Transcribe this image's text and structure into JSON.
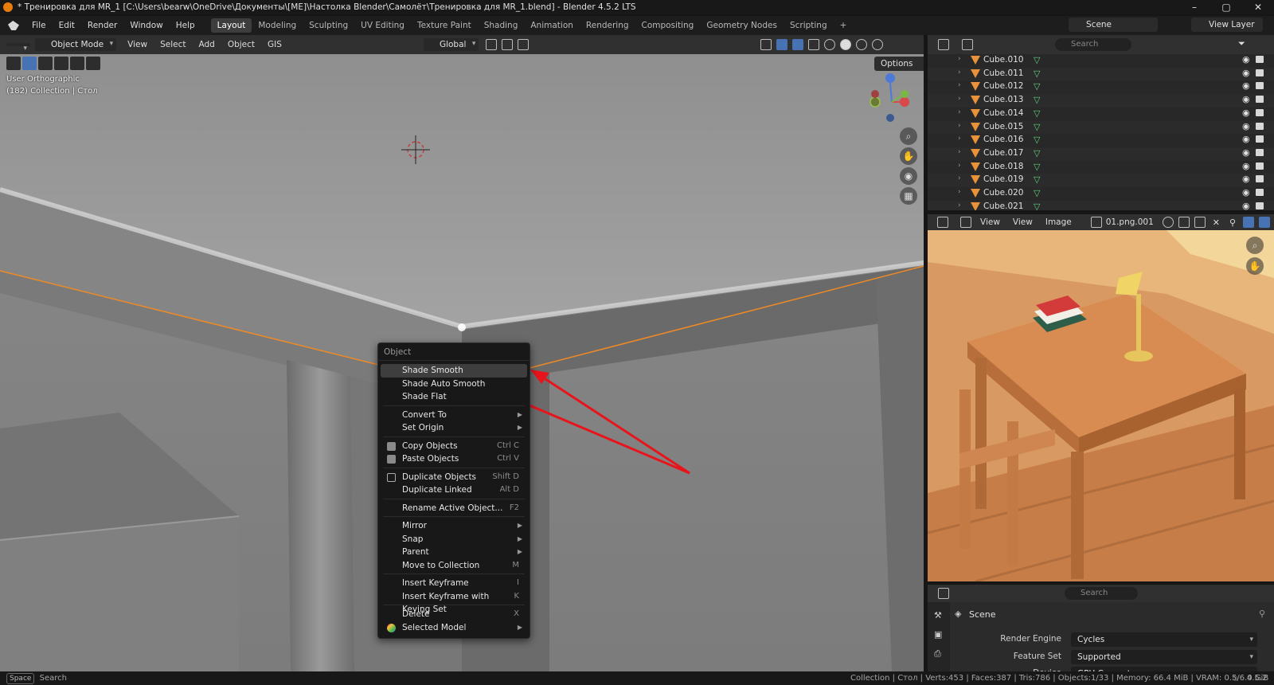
{
  "window": {
    "title": "* Тренировка для MR_1 [C:\\Users\\bearw\\OneDrive\\Документы\\[ME]\\Настолка Blender\\Самолёт\\Тренировка для MR_1.blend] - Blender 4.5.2 LTS",
    "minimize": "–",
    "maximize": "▢",
    "close": "✕"
  },
  "menu": [
    "File",
    "Edit",
    "Render",
    "Window",
    "Help"
  ],
  "workspaces": [
    "Layout",
    "Modeling",
    "Sculpting",
    "UV Editing",
    "Texture Paint",
    "Shading",
    "Animation",
    "Rendering",
    "Compositing",
    "Geometry Nodes",
    "Scripting"
  ],
  "active_workspace": "Layout",
  "add_workspace": "+",
  "scene": {
    "label": "Scene",
    "view_layer": "View Layer"
  },
  "viewport_header": {
    "mode": "Object Mode",
    "items": [
      "View",
      "Select",
      "Add",
      "Object",
      "GIS"
    ],
    "transform": "Global",
    "options": "Options"
  },
  "viewport_info": {
    "view": "User Orthographic",
    "collection": "(182) Collection | Стол"
  },
  "context_menu": {
    "title": "Object",
    "groups": [
      [
        {
          "label": "Shade Smooth",
          "shortcut": "",
          "highlight": true
        },
        {
          "label": "Shade Auto Smooth",
          "shortcut": ""
        },
        {
          "label": "Shade Flat",
          "shortcut": ""
        }
      ],
      [
        {
          "label": "Convert To",
          "submenu": true
        },
        {
          "label": "Set Origin",
          "submenu": true
        }
      ],
      [
        {
          "label": "Copy Objects",
          "shortcut": "Ctrl C",
          "icon": "copy-icon"
        },
        {
          "label": "Paste Objects",
          "shortcut": "Ctrl V",
          "icon": "paste-icon"
        }
      ],
      [
        {
          "label": "Duplicate Objects",
          "shortcut": "Shift D",
          "icon": "duplicate-icon"
        },
        {
          "label": "Duplicate Linked",
          "shortcut": "Alt D"
        }
      ],
      [
        {
          "label": "Rename Active Object...",
          "shortcut": "F2"
        }
      ],
      [
        {
          "label": "Mirror",
          "submenu": true
        },
        {
          "label": "Snap",
          "submenu": true
        },
        {
          "label": "Parent",
          "submenu": true
        },
        {
          "label": "Move to Collection",
          "shortcut": "M"
        }
      ],
      [
        {
          "label": "Insert Keyframe",
          "shortcut": "I"
        },
        {
          "label": "Insert Keyframe with Keying Set",
          "shortcut": "K"
        }
      ],
      [
        {
          "label": "Delete",
          "shortcut": "X"
        },
        {
          "label": "Selected Model",
          "submenu": true,
          "icon": "addon-cube-icon"
        }
      ]
    ]
  },
  "outliner": {
    "search_placeholder": "Search",
    "items": [
      "Cube.010",
      "Cube.011",
      "Cube.012",
      "Cube.013",
      "Cube.014",
      "Cube.015",
      "Cube.016",
      "Cube.017",
      "Cube.018",
      "Cube.019",
      "Cube.020",
      "Cube.021"
    ]
  },
  "image_editor": {
    "items": [
      "View",
      "View",
      "Image"
    ],
    "image_name": "01.png.001"
  },
  "properties": {
    "search_placeholder": "Search",
    "scene_label": "Scene",
    "rows": [
      {
        "label": "Render Engine",
        "value": "Cycles"
      },
      {
        "label": "Feature Set",
        "value": "Supported"
      },
      {
        "label": "Device",
        "value": "GPU Compute"
      }
    ]
  },
  "status_bar": {
    "key": "Space",
    "action": "Search",
    "stats": "Collection | Стол | Verts:453 | Faces:387 | Tris:786 | Objects:1/33 | Memory: 66.4 MiB | VRAM: 0.5/6.0 GiB",
    "version": "4.5.2"
  },
  "colors": {
    "accent_blue": "#4772b3",
    "selection_orange": "#f08a24",
    "annotation_arrow": "#e8141c"
  }
}
